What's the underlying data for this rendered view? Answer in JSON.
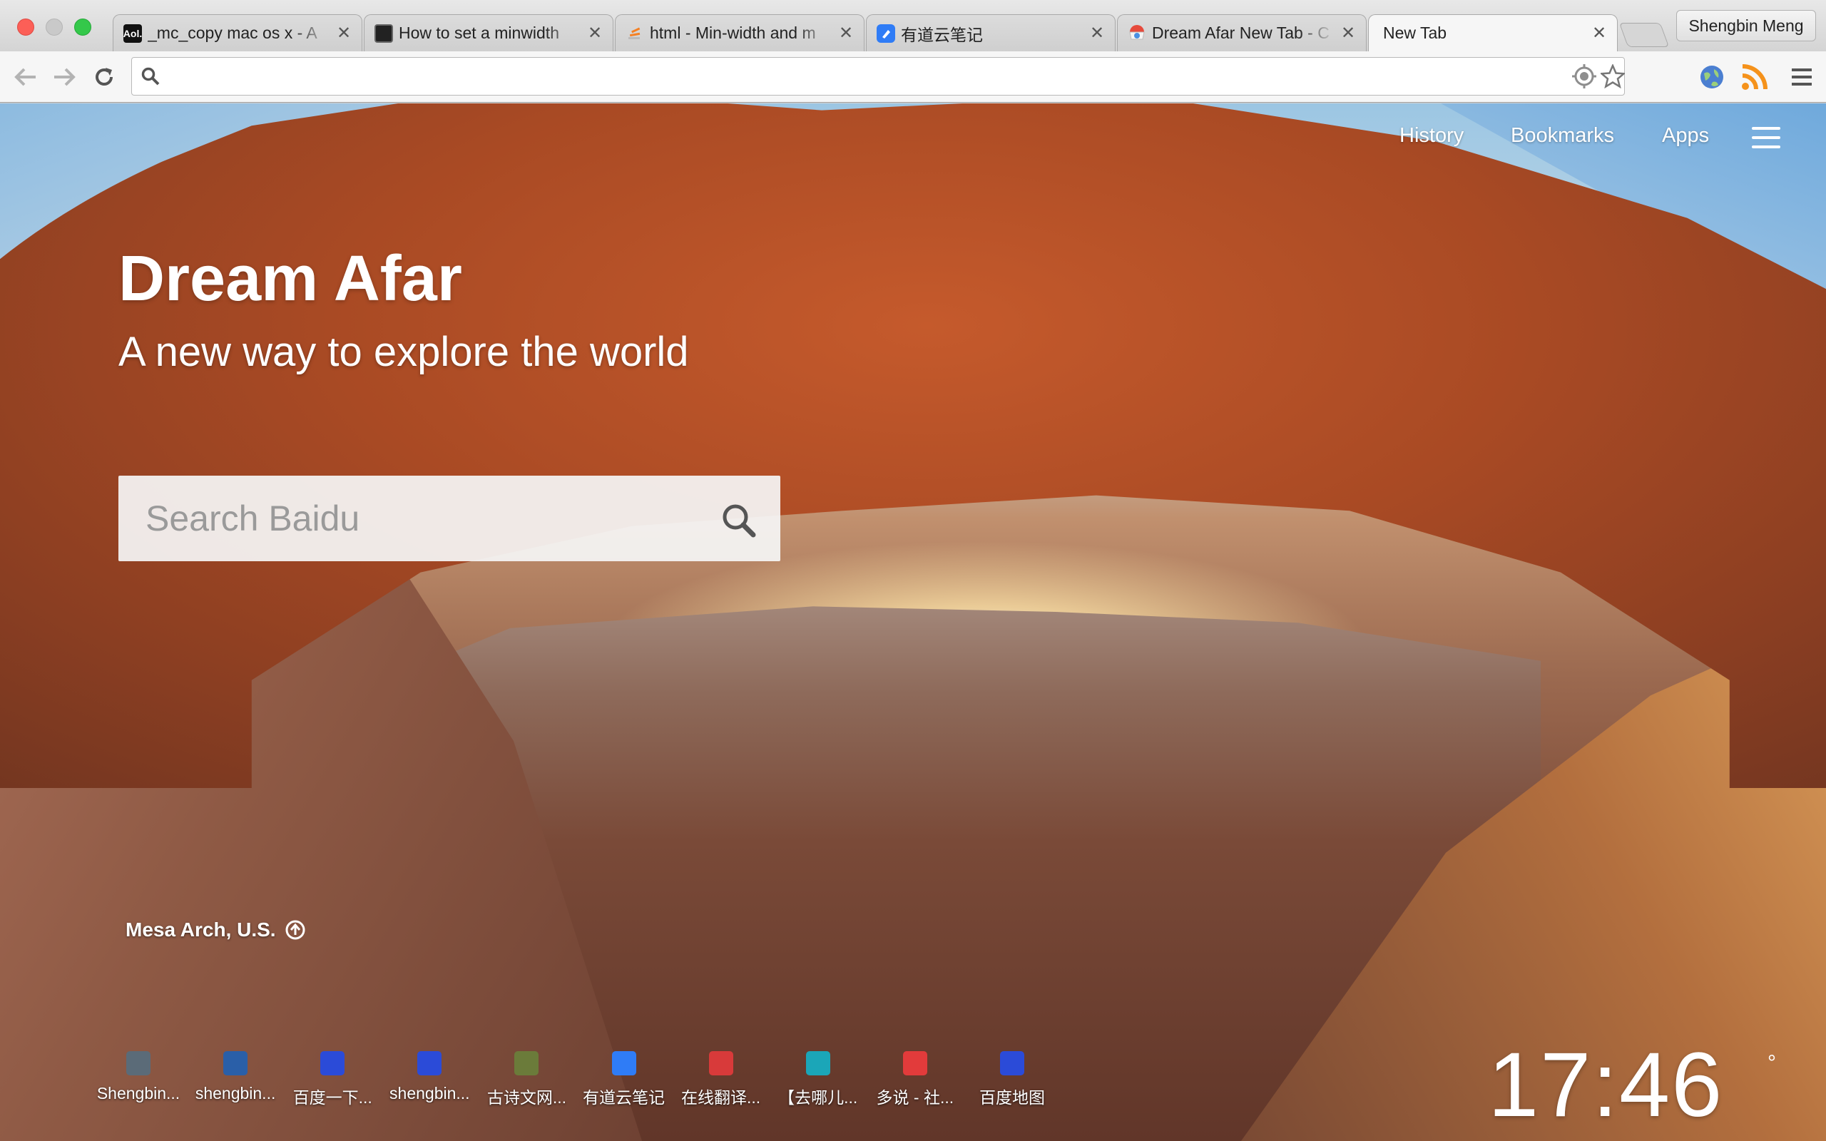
{
  "window": {
    "traffic_lights": [
      "close",
      "minimize",
      "zoom"
    ]
  },
  "tabs": [
    {
      "title": "_mc_copy mac os x - A",
      "favicon": "aol-favicon",
      "favicon_text": "Aol.",
      "favicon_color": "#111111",
      "active": false
    },
    {
      "title": "How to set a minwidth",
      "favicon": "terminal-favicon",
      "favicon_text": "",
      "favicon_color": "#222222",
      "active": false
    },
    {
      "title": "html - Min-width and m",
      "favicon": "stackoverflow-favicon",
      "favicon_text": "",
      "favicon_color": "#f48024",
      "active": false
    },
    {
      "title": "有道云笔记",
      "favicon": "youdao-note-favicon",
      "favicon_text": "",
      "favicon_color": "#2f7cf6",
      "active": false
    },
    {
      "title": "Dream Afar New Tab - C",
      "favicon": "chrome-webstore-favicon",
      "favicon_text": "",
      "favicon_color": "#e64a3b",
      "active": false
    },
    {
      "title": "New Tab",
      "favicon": "",
      "favicon_text": "",
      "favicon_color": "",
      "active": true
    }
  ],
  "profile": {
    "name": "Shengbin Meng"
  },
  "toolbar": {
    "omnibox_value": "",
    "icons": [
      "back-icon",
      "forward-icon",
      "reload-icon",
      "search-icon",
      "target-icon",
      "bookmark-star-icon",
      "globe-icon",
      "rss-icon",
      "chrome-menu-icon"
    ]
  },
  "page": {
    "nav": {
      "history": "History",
      "bookmarks": "Bookmarks",
      "apps": "Apps"
    },
    "brand": {
      "title": "Dream Afar",
      "subtitle": "A new way to explore the world"
    },
    "search": {
      "placeholder": "Search Baidu",
      "value": ""
    },
    "location": "Mesa Arch, U.S.",
    "shortcuts": [
      {
        "label": "Shengbin...",
        "icon": "avatar-icon",
        "color": "#5b6b78"
      },
      {
        "label": "shengbin...",
        "icon": "shield-icon",
        "color": "#2a5fa8"
      },
      {
        "label": "百度一下...",
        "icon": "baidu-paw-icon",
        "color": "#2b4bd8"
      },
      {
        "label": "shengbin...",
        "icon": "baidu-paw-icon",
        "color": "#2b4bd8"
      },
      {
        "label": "古诗文网...",
        "icon": "gushiwen-icon",
        "color": "#6b7b3a"
      },
      {
        "label": "有道云笔记",
        "icon": "youdao-note-icon",
        "color": "#2f7cf6"
      },
      {
        "label": "在线翻译...",
        "icon": "translate-icon",
        "color": "#d83a3a"
      },
      {
        "label": "【去哪儿...",
        "icon": "qunar-camel-icon",
        "color": "#1ba6b8"
      },
      {
        "label": "多说 - 社...",
        "icon": "duoshuo-icon",
        "color": "#e23b3b"
      },
      {
        "label": "百度地图",
        "icon": "baidu-map-icon",
        "color": "#2b4bd8"
      }
    ],
    "clock": "17:46",
    "weather_degree": "°"
  }
}
